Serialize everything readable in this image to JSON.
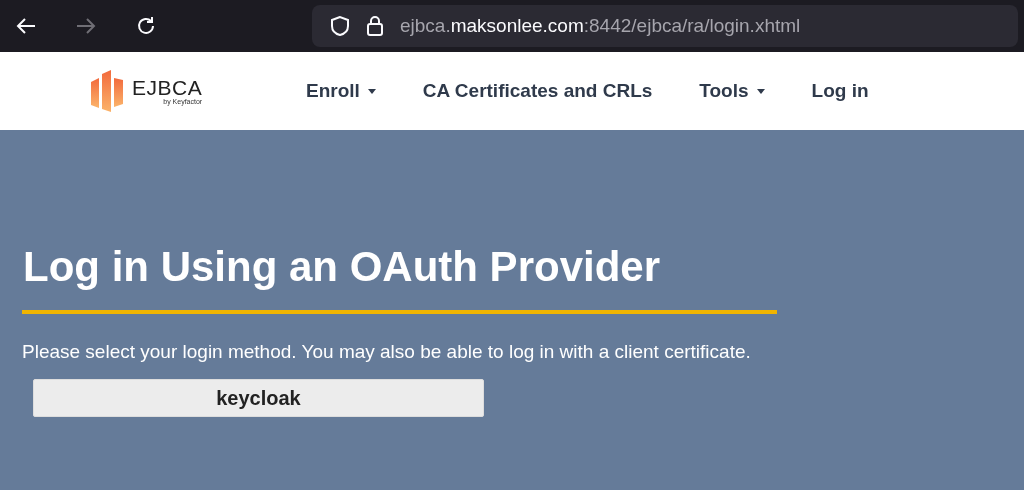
{
  "browser": {
    "url": {
      "prefix": "ejbca.",
      "host": "maksonlee.com",
      "path": ":8442/ejbca/ra/login.xhtml"
    },
    "forward_disabled": true
  },
  "logo": {
    "name": "EJBCA",
    "tagline": "by Keyfactor"
  },
  "nav": [
    {
      "label": "Enroll",
      "has_dropdown": true
    },
    {
      "label": "CA Certificates and CRLs",
      "has_dropdown": false
    },
    {
      "label": "Tools",
      "has_dropdown": true
    },
    {
      "label": "Log in",
      "has_dropdown": false
    }
  ],
  "heading": "Log in Using an OAuth Provider",
  "instructions": "Please select your login method. You may also be able to log in with a client certificate.",
  "providers": [
    "keycloak"
  ]
}
